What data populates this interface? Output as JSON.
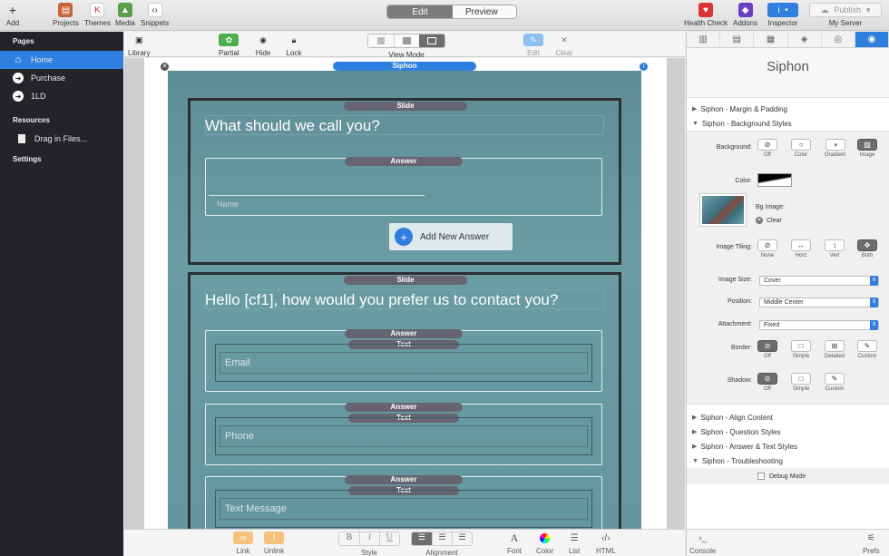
{
  "topbar": {
    "add": "Add",
    "projects": "Projects",
    "themes": "Themes",
    "media": "Media",
    "snippets": "Snippets",
    "edit_tab": "Edit",
    "preview_tab": "Preview",
    "health_check": "Health Check",
    "addons": "Addons",
    "inspector": "Inspector",
    "publish": "Publish",
    "my_server": "My Server"
  },
  "sidebar": {
    "pages_heading": "Pages",
    "pages": [
      {
        "label": "Home",
        "active": true
      },
      {
        "label": "Purchase",
        "active": false
      },
      {
        "label": "1LD",
        "active": false
      }
    ],
    "resources_heading": "Resources",
    "drag_files": "Drag in Files...",
    "settings_heading": "Settings"
  },
  "toolbar2": {
    "library": "Library",
    "partial": "Partial",
    "hide": "Hide",
    "lock": "Lock",
    "view_mode": "View Mode",
    "edit": "Edit",
    "clear": "Clear"
  },
  "canvas": {
    "siphon_label": "Siphon",
    "slide1": {
      "label": "Slide",
      "question": "What should we call you?",
      "answer_label": "Answer",
      "name_placeholder": "Name",
      "add_answer": "Add New Answer"
    },
    "slide2": {
      "label": "Slide",
      "question": "Hello [cf1], how would you prefer us to contact you?",
      "answers": [
        {
          "label": "Answer",
          "text_label": "Text",
          "placeholder": "Email"
        },
        {
          "label": "Answer",
          "text_label": "Text",
          "placeholder": "Phone"
        },
        {
          "label": "Answer",
          "text_label": "Text",
          "placeholder": "Text Message"
        }
      ]
    }
  },
  "rpanel": {
    "title": "Siphon",
    "sections": {
      "margin": "Siphon - Margin & Padding",
      "bg": "Siphon - Background Styles",
      "align": "Siphon - Align Content",
      "question": "Siphon - Question Styles",
      "answer": "Siphon - Answer & Text Styles",
      "trouble": "Siphon - Troubleshooting"
    },
    "background_label": "Background:",
    "background_opts": [
      "Off",
      "Color",
      "Gradient",
      "Image"
    ],
    "color_label": "Color:",
    "bg_image_label": "Bg Image:",
    "clear": "Clear",
    "tiling_label": "Image Tiling:",
    "tiling_opts": [
      "None",
      "Horz",
      "Vert",
      "Both"
    ],
    "size_label": "Image Size:",
    "size_value": "Cover",
    "position_label": "Position:",
    "position_value": "Middle Center",
    "attachment_label": "Attachment:",
    "attachment_value": "Fixed",
    "border_label": "Border:",
    "border_opts": [
      "Off",
      "Simple",
      "Detailed",
      "Custom"
    ],
    "shadow_label": "Shadow:",
    "shadow_opts": [
      "Off",
      "Simple",
      "Custom"
    ],
    "debug_mode": "Debug Mode"
  },
  "bottombar": {
    "link": "Link",
    "unlink": "Unlink",
    "style": "Style",
    "alignment": "Alignment",
    "font": "Font",
    "color": "Color",
    "list": "List",
    "html": "HTML",
    "console": "Console",
    "prefs": "Prefs"
  },
  "colors": {
    "accent": "#2f7fe0",
    "sidebar_bg": "#222427",
    "canvas_teal": "#64969f"
  }
}
